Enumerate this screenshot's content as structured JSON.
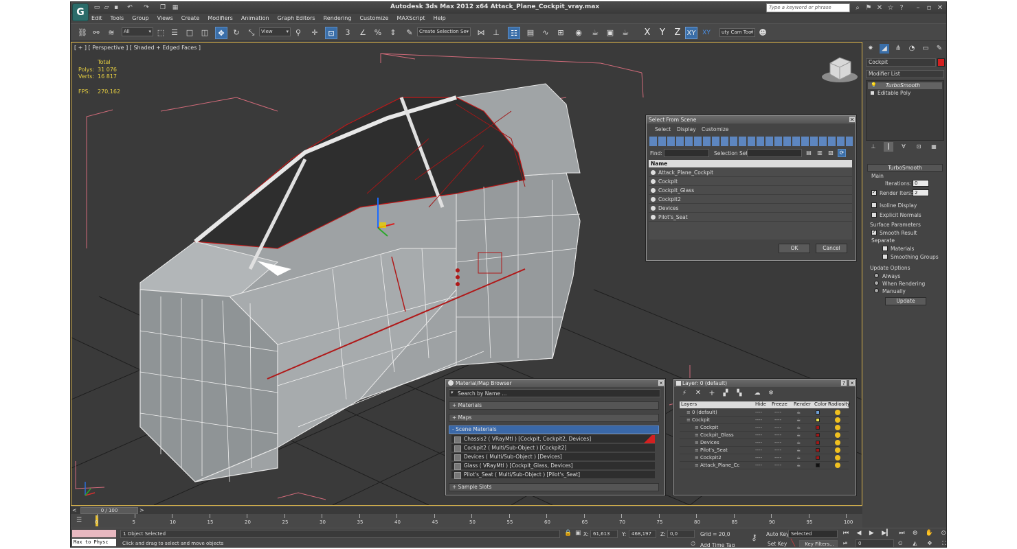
{
  "titlebar": {
    "title": "Autodesk 3ds Max  2012 x64     Attack_Plane_Cockpit_vray.max",
    "search_placeholder": "Type a keyword or phrase"
  },
  "menu": [
    "Edit",
    "Tools",
    "Group",
    "Views",
    "Create",
    "Modifiers",
    "Animation",
    "Graph Editors",
    "Rendering",
    "Customize",
    "MAXScript",
    "Help"
  ],
  "toolbar": {
    "selection_filter": "All",
    "ref_coord": "View",
    "named_selection": "Create Selection Se",
    "axes": [
      "X",
      "Y",
      "Z",
      "XY"
    ],
    "xy_sub": "XY",
    "camera_tool": "uty Cam Tool ▾"
  },
  "viewport": {
    "label": "[ + ] [ Perspective ] [ Shaded + Edged Faces ]",
    "stats": {
      "total_label": "Total",
      "polys_label": "Polys:",
      "polys": "31 076",
      "verts_label": "Verts:",
      "verts": "16 817",
      "fps_label": "FPS:",
      "fps": "270,162"
    }
  },
  "cmdpanel": {
    "object_name": "Cockpit",
    "object_color": "#d42020",
    "modifier_list": "Modifier List",
    "stack": [
      "TurboSmooth",
      "Editable Poly"
    ],
    "rollout": "TurboSmooth",
    "main_label": "Main",
    "iterations_label": "Iterations:",
    "iterations": "0",
    "render_iters_label": "Render Iters:",
    "render_iters": "2",
    "isoline_label": "Isoline Display",
    "explicit_label": "Explicit Normals",
    "surface_label": "Surface Parameters",
    "smooth_result_label": "Smooth Result",
    "separate_label": "Separate",
    "materials_label": "Materials",
    "smoothing_groups_label": "Smoothing Groups",
    "update_options_label": "Update Options",
    "always_label": "Always",
    "when_rendering_label": "When Rendering",
    "manually_label": "Manually",
    "update_button": "Update"
  },
  "select_from_scene": {
    "title": "Select From Scene",
    "menu": [
      "Select",
      "Display",
      "Customize"
    ],
    "find_label": "Find:",
    "selection_set_label": "Selection Set:",
    "column_name": "Name",
    "items": [
      "Attack_Plane_Cockpit",
      "Cockpit",
      "Cockpit_Glass",
      "Cockpit2",
      "Devices",
      "Pilot's_Seat"
    ],
    "ok": "OK",
    "cancel": "Cancel"
  },
  "material_browser": {
    "title": "Material/Map Browser",
    "search_placeholder": "Search by Name ...",
    "sections": [
      "+ Materials",
      "+ Maps",
      "- Scene Materials",
      "+ Sample Slots"
    ],
    "materials": [
      "Chassis2  ( VRayMtl )  [Cockpit, Cockpit2, Devices]",
      "Cockpit2  ( Multi/Sub-Object )  [Cockpit2]",
      "Devices  ( Multi/Sub-Object )  [Devices]",
      "Glass  ( VRayMtl )  [Cockpit_Glass, Devices]",
      "Pilot's_Seat  ( Multi/Sub-Object )  [Pilot's_Seat]"
    ]
  },
  "layer_manager": {
    "title": "Layer: 0 (default)",
    "help": "?",
    "columns": [
      "Layers",
      "Hide",
      "Freeze",
      "Render",
      "Color",
      "Radiosity"
    ],
    "rows": [
      {
        "name": "0 (default)",
        "color": "#6ea0d8",
        "level": 0
      },
      {
        "name": "Cockpit",
        "color": "#e8e050",
        "level": 0
      },
      {
        "name": "Cockpit",
        "color": "#a01818",
        "level": 1
      },
      {
        "name": "Cockpit_Glass",
        "color": "#a01818",
        "level": 1
      },
      {
        "name": "Devices",
        "color": "#a01818",
        "level": 1
      },
      {
        "name": "Pilot's_Seat",
        "color": "#a01818",
        "level": 1
      },
      {
        "name": "Cockpit2",
        "color": "#a01818",
        "level": 1
      },
      {
        "name": "Attack_Plane_Cc",
        "color": "#111111",
        "level": 1
      }
    ],
    "dash": "----"
  },
  "timeline": {
    "frame": "0 / 100",
    "ticks": [
      "0",
      "5",
      "10",
      "15",
      "20",
      "25",
      "30",
      "35",
      "40",
      "45",
      "50",
      "55",
      "60",
      "65",
      "70",
      "75",
      "80",
      "85",
      "90",
      "95",
      "100"
    ]
  },
  "status": {
    "maxscript": "Max to Physc",
    "selected": "1 Object Selected",
    "prompt": "Click and drag to select and move objects",
    "x_label": "X:",
    "x": "61,613",
    "y_label": "Y:",
    "y": "468,197",
    "z_label": "Z:",
    "z": "0,0",
    "grid": "Grid = 20,0",
    "add_time_tag": "Add Time Tag",
    "auto_key": "Auto Key",
    "key_mode": "Selected",
    "set_key": "Set Key",
    "key_filters": "Key Filters...",
    "frame": "0"
  }
}
